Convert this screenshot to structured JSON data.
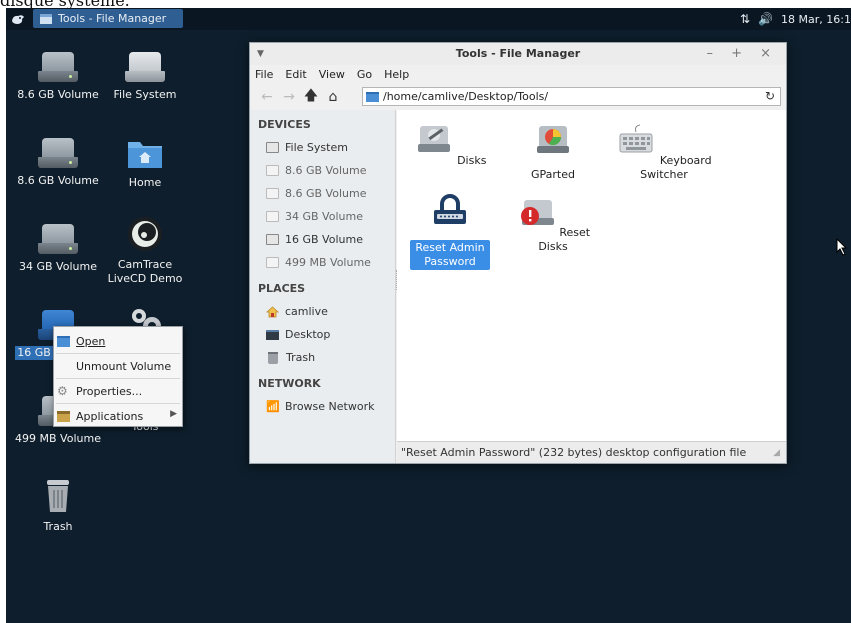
{
  "top_strip_text": "disque système.",
  "panel": {
    "task_button": "Tools - File Manager",
    "network_indicator": "⇅",
    "volume_indicator": "🔊",
    "clock": "18 Mar, 16:1"
  },
  "desktop_icons": [
    {
      "label": "8.6 GB Volume"
    },
    {
      "label": "File System"
    },
    {
      "label": "8.6 GB Volume"
    },
    {
      "label": "Home"
    },
    {
      "label": "34 GB Volume"
    },
    {
      "label": "CamTrace LiveCD Demo"
    },
    {
      "label": "16 GB"
    },
    {
      "label": "499 MB Volume"
    },
    {
      "label": "Tools"
    },
    {
      "label": "Trash"
    }
  ],
  "window": {
    "title": "Tools - File Manager",
    "controls": "– + ×",
    "menu": [
      "File",
      "Edit",
      "View",
      "Go",
      "Help"
    ],
    "location": "/home/camlive/Desktop/Tools/",
    "sidebar": {
      "devices_header": "DEVICES",
      "devices": [
        "File System",
        "8.6 GB Volume",
        "8.6 GB Volume",
        "34 GB Volume",
        "16 GB Volume",
        "499 MB Volume"
      ],
      "places_header": "PLACES",
      "places": [
        "camlive",
        "Desktop",
        "Trash"
      ],
      "network_header": "NETWORK",
      "network": [
        "Browse Network"
      ]
    },
    "files": [
      {
        "label": "Disks"
      },
      {
        "label": "GParted"
      },
      {
        "label": "Keyboard Switcher"
      },
      {
        "label": "Reset Admin Password"
      },
      {
        "label": "Reset Disks"
      }
    ],
    "status": "\"Reset Admin Password\" (232 bytes) desktop configuration file"
  },
  "context_menu": {
    "open": "Open",
    "unmount": "Unmount Volume",
    "properties": "Properties...",
    "applications": "Applications"
  },
  "colors": {
    "desktop_bg": "#0e1e2c",
    "selection": "#3a8ee6",
    "task_button": "#2f5e92"
  }
}
